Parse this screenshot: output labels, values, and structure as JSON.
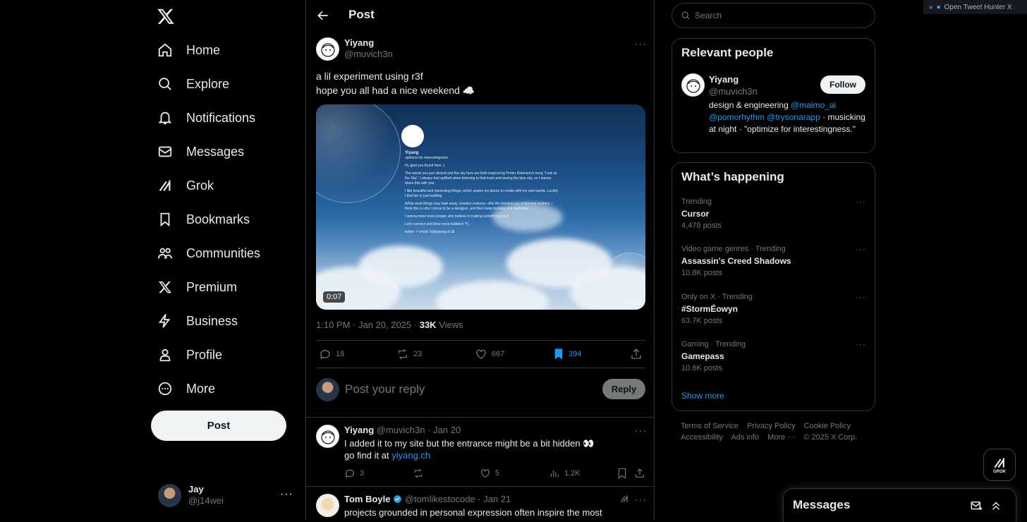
{
  "nav": {
    "items": [
      {
        "label": "Home",
        "icon": "home-icon"
      },
      {
        "label": "Explore",
        "icon": "search-icon"
      },
      {
        "label": "Notifications",
        "icon": "bell-icon"
      },
      {
        "label": "Messages",
        "icon": "envelope-icon"
      },
      {
        "label": "Grok",
        "icon": "grok-icon"
      },
      {
        "label": "Bookmarks",
        "icon": "bookmark-icon"
      },
      {
        "label": "Communities",
        "icon": "people-icon"
      },
      {
        "label": "Premium",
        "icon": "x-logo-icon"
      },
      {
        "label": "Business",
        "icon": "lightning-icon"
      },
      {
        "label": "Profile",
        "icon": "person-icon"
      },
      {
        "label": "More",
        "icon": "more-circle-icon"
      }
    ],
    "post_label": "Post",
    "account": {
      "name": "Jay",
      "handle": "@j14wei"
    }
  },
  "header": {
    "title": "Post"
  },
  "post": {
    "author": {
      "name": "Yiyang",
      "handle": "@muvich3n"
    },
    "text_line1": "a lil experiment using r3f",
    "text_line2": "hope you all had a nice weekend ☁️",
    "media": {
      "duration": "0:07",
      "name": "Yiyang",
      "tagline": "optimize for interestingness",
      "greeting": "Hi, glad you found here :)",
      "para1": "The words you just clicked and the sky here are both inspired by Porter Robinson's song \"Look at the Sky\". I always feel uplifted when listening to that track and seeing the blue sky, so I wanna share this with you.",
      "para2": "I like beautiful and interesting things, which sparks my desire to create with my own hands. Luckily, I find fun in just building.",
      "para3": "While most things may fade away, creation endures—like the timeless joy of blowing bubbles. I think this is why I chose to be a designer, and then keep building and exploring.",
      "para4": "I wanna meet more people who believe in making something good.",
      "para5": "Let's connect and blow more bubbles! 🫧",
      "contacts": "twitter ↗   email: hi@yiyang.ch ⧉"
    },
    "time": "1:10 PM · Jan 20, 2025 ·",
    "views": "33K",
    "views_label": "Views",
    "stats": {
      "replies": "18",
      "reposts": "23",
      "likes": "667",
      "bookmarks": "394"
    },
    "reply_placeholder": "Post your reply",
    "reply_button": "Reply"
  },
  "replies": [
    {
      "name": "Yiyang",
      "meta": "@muvich3n · Jan 20",
      "line1": "I added it to my site but the entrance might be a bit hidden 👀",
      "line2_prefix": "go find it at ",
      "line2_link": "yiyang.ch",
      "stats": {
        "replies": "3",
        "likes": "5",
        "views": "1.2K"
      }
    },
    {
      "name": "Tom Boyle",
      "meta": "@tomlikestocode · Jan 21",
      "line1": "projects grounded in personal expression often inspire the most"
    }
  ],
  "right": {
    "search_placeholder": "Search",
    "relevant": {
      "title": "Relevant people",
      "name": "Yiyang",
      "handle": "@muvich3n",
      "follow": "Follow",
      "bio_1": "design & engineering ",
      "bio_link1": "@maimo_ai",
      "bio_link2": "@pomorhythm",
      "bio_link3": "@trysonarapp",
      "bio_2": " · musicking at night · \"optimize for interestingness.\""
    },
    "happening": {
      "title": "What’s happening",
      "trends": [
        {
          "category": "Trending",
          "title": "Cursor",
          "count": "4,478 posts"
        },
        {
          "category": "Video game genres · Trending",
          "title": "Assassin's Creed Shadows",
          "count": "10.8K posts"
        },
        {
          "category": "Only on X · Trending",
          "title": "#StormÉowyn",
          "count": "63.7K posts"
        },
        {
          "category": "Gaming · Trending",
          "title": "Gamepass",
          "count": "10.6K posts"
        }
      ],
      "show_more": "Show more"
    },
    "footer": {
      "links": [
        "Terms of Service",
        "Privacy Policy",
        "Cookie Policy",
        "Accessibility",
        "Ads info",
        "More ···"
      ],
      "copyright": "© 2025 X Corp."
    }
  },
  "extension": {
    "label": "Open Tweet Hunter X"
  },
  "grok_button": {
    "label": "GROK"
  },
  "messages_drawer": {
    "title": "Messages"
  }
}
